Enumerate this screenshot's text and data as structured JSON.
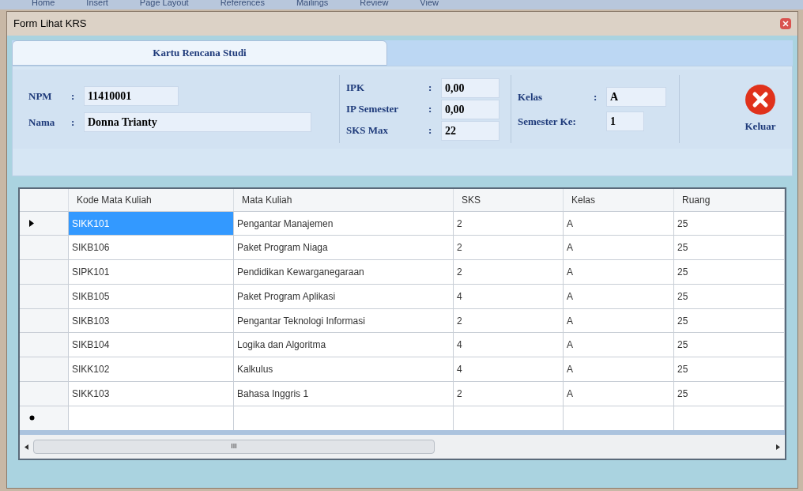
{
  "background_menu": [
    "Home",
    "Insert",
    "Page Layout",
    "References",
    "Mailings",
    "Review",
    "View"
  ],
  "window": {
    "title": "Form Lihat KRS"
  },
  "tabs": [
    {
      "label": "Kartu Rencana Studi",
      "selected": true
    }
  ],
  "student": {
    "fields": [
      {
        "label": "NPM",
        "separator": ":",
        "value": "11410001"
      },
      {
        "label": "Nama",
        "separator": ":",
        "value": "Donna Trianty"
      }
    ]
  },
  "grades": {
    "fields": [
      {
        "label": "IPK",
        "separator": ":",
        "value": "0,00"
      },
      {
        "label": "IP Semester",
        "separator": ":",
        "value": "0,00"
      },
      {
        "label": "SKS Max",
        "separator": ":",
        "value": "22"
      }
    ]
  },
  "class_info": {
    "fields": [
      {
        "label": "Kelas",
        "separator": ":",
        "value": "A"
      },
      {
        "label": "Semester Ke:",
        "value": "1"
      }
    ]
  },
  "exit_button": {
    "label": "Keluar"
  },
  "table": {
    "columns": [
      "Kode Mata Kuliah",
      "Mata Kuliah",
      "SKS",
      "Kelas",
      "Ruang"
    ],
    "rows": [
      {
        "selected": true,
        "cells": [
          "SIKK101",
          "Pengantar Manajemen",
          "2",
          "A",
          "25"
        ]
      },
      {
        "selected": false,
        "cells": [
          "SIKB106",
          "Paket Program Niaga",
          "2",
          "A",
          "25"
        ]
      },
      {
        "selected": false,
        "cells": [
          "SIPK101",
          "Pendidikan Kewarganegaraan",
          "2",
          "A",
          "25"
        ]
      },
      {
        "selected": false,
        "cells": [
          "SIKB105",
          "Paket Program Aplikasi",
          "4",
          "A",
          "25"
        ]
      },
      {
        "selected": false,
        "cells": [
          "SIKB103",
          "Pengantar Teknologi Informasi",
          "2",
          "A",
          "25"
        ]
      },
      {
        "selected": false,
        "cells": [
          "SIKB104",
          "Logika dan Algoritma",
          "4",
          "A",
          "25"
        ]
      },
      {
        "selected": false,
        "cells": [
          "SIKK102",
          "Kalkulus",
          "4",
          "A",
          "25"
        ]
      },
      {
        "selected": false,
        "cells": [
          "SIKK103",
          "Bahasa Inggris 1",
          "2",
          "A",
          "25"
        ]
      }
    ],
    "scrollbar_mark": "III"
  }
}
